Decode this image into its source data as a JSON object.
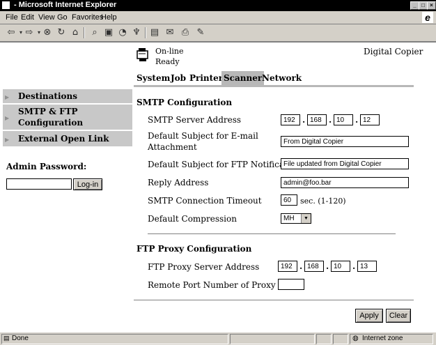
{
  "window": {
    "title": " - Microsoft Internet Explorer"
  },
  "menu": [
    "File",
    "Edit",
    "View",
    "Go",
    "Favorites",
    "Help"
  ],
  "toolbar_icons": [
    "back-icon",
    "forward-icon",
    "stop-icon",
    "refresh-icon",
    "home-icon",
    "search-icon",
    "favorites-icon",
    "history-icon",
    "channels-icon",
    "fullscreen-icon",
    "mail-icon",
    "print-icon",
    "edit-icon"
  ],
  "device": {
    "status_line1": "On-line",
    "status_line2": "Ready",
    "name": "Digital Copier"
  },
  "tabs": [
    "System",
    "Job",
    "Printer",
    "Scanner",
    "Network"
  ],
  "active_tab": "Scanner",
  "sidebar": {
    "items": [
      {
        "label_line1": "Destinations",
        "label_line2": ""
      },
      {
        "label_line1": "SMTP & FTP",
        "label_line2": "Configuration"
      },
      {
        "label_line1": "External Open Link",
        "label_line2": ""
      }
    ],
    "admin_label": "Admin Password:",
    "password_value": "",
    "login_label": "Log-in"
  },
  "smtp": {
    "heading": "SMTP Configuration",
    "server_label": "SMTP Server Address",
    "ip": [
      "192",
      "168",
      "10",
      "12"
    ],
    "subject_email_line1": "Default Subject for E-mail",
    "subject_email_line2": "Attachment",
    "subject_email_value": "From Digital Copier",
    "subject_ftp_label": "Default Subject for FTP Notification",
    "subject_ftp_value": "File updated from Digital Copier",
    "reply_label": "Reply Address",
    "reply_value": "admin@foo.bar",
    "timeout_label": "SMTP Connection Timeout",
    "timeout_value": "60",
    "timeout_unit": "sec. (1-120)",
    "compression_label": "Default Compression",
    "compression_value": "MH"
  },
  "ftp": {
    "heading": "FTP Proxy Configuration",
    "server_label": "FTP Proxy Server Address",
    "ip": [
      "192",
      "168",
      "10",
      "13"
    ],
    "port_label": "Remote Port Number of Proxy",
    "port_value": ""
  },
  "actions": {
    "apply": "Apply",
    "clear": "Clear"
  },
  "statusbar": {
    "left": "Done",
    "zone": "Internet zone"
  }
}
